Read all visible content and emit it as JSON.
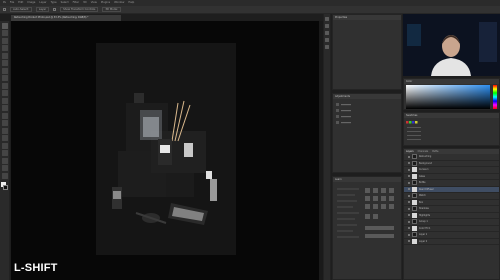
{
  "menu": [
    "Ps",
    "File",
    "Edit",
    "Image",
    "Layer",
    "Type",
    "Select",
    "Filter",
    "3D",
    "View",
    "Plugins",
    "Window",
    "Help"
  ],
  "options": {
    "items": [
      "Auto-Select:",
      "Layer",
      "Show Transform Controls",
      "3D Mode:"
    ]
  },
  "document": {
    "tab_title": "Retouching Product Photo.psd @ 33.3% (Retouching, RGB/8) *"
  },
  "overlay": {
    "watermark": "L-SHIFT"
  },
  "panels": {
    "properties": "Properties",
    "adjustments": "Adjustments",
    "learn": "Learn",
    "color": "Color",
    "swatches": "Swatches",
    "layers_tabs": [
      "Layers",
      "Channels",
      "Paths"
    ],
    "layers": [
      {
        "name": "Retouching",
        "thumb": "dark",
        "selected": false
      },
      {
        "name": "Background",
        "thumb": "dark",
        "selected": false
      },
      {
        "name": "Curves 1",
        "thumb": "light",
        "selected": false
      },
      {
        "name": "Glass",
        "thumb": "light",
        "selected": false
      },
      {
        "name": "Bottle",
        "thumb": "dark",
        "selected": false
      },
      {
        "name": "Reed Diffuser",
        "thumb": "light",
        "selected": true
      },
      {
        "name": "Watch",
        "thumb": "dark",
        "selected": false
      },
      {
        "name": "Box",
        "thumb": "light",
        "selected": false
      },
      {
        "name": "Shadows",
        "thumb": "dark",
        "selected": false
      },
      {
        "name": "Highlights",
        "thumb": "light",
        "selected": false
      },
      {
        "name": "Group 1",
        "thumb": "dark",
        "selected": false
      },
      {
        "name": "Color Fill 1",
        "thumb": "light",
        "selected": false
      },
      {
        "name": "Layer 1",
        "thumb": "dark",
        "selected": false
      },
      {
        "name": "Layer 2",
        "thumb": "light",
        "selected": false
      }
    ]
  },
  "colors": {
    "accent": "#2e8ff0",
    "selected_layer": "#3f4d63"
  }
}
